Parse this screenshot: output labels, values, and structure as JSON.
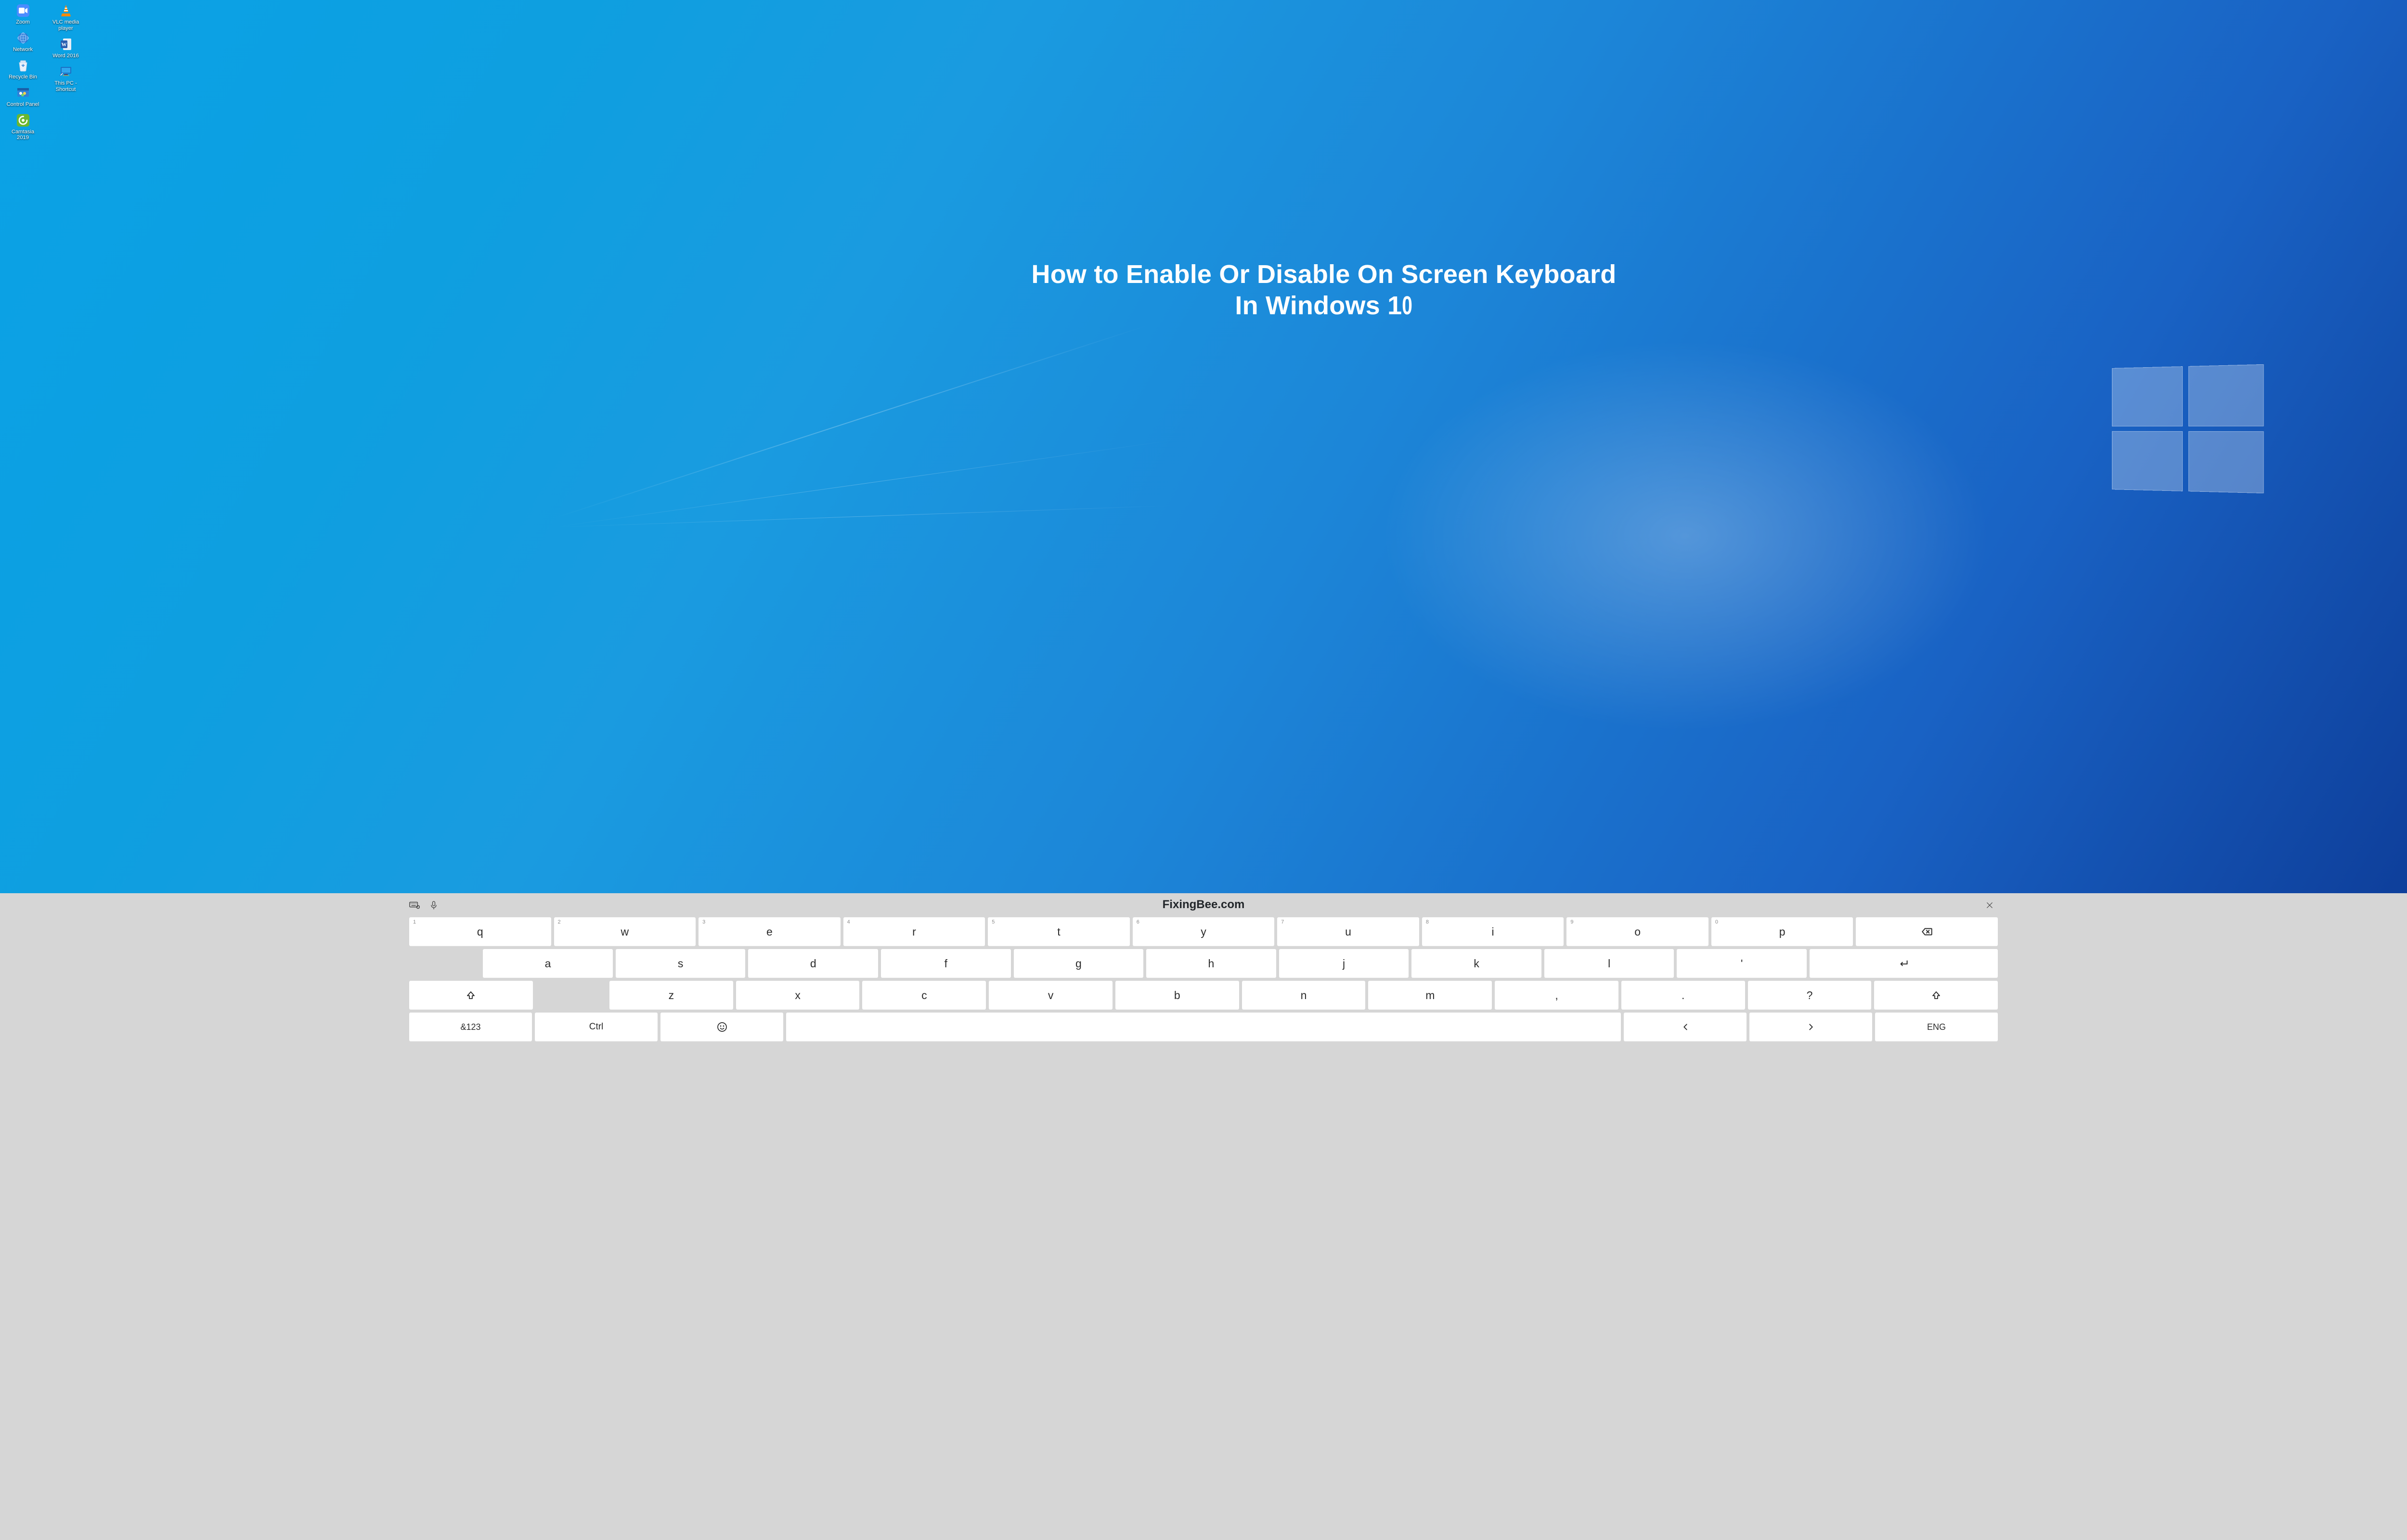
{
  "headline": {
    "line1": "How to Enable Or Disable On Screen Keyboard",
    "line2_a": "In Windows 1",
    "line2_b": "0"
  },
  "brand": "FixingBee.com",
  "desktop": {
    "col1": [
      {
        "id": "zoom",
        "label": "Zoom"
      },
      {
        "id": "network",
        "label": "Network"
      },
      {
        "id": "recycle",
        "label": "Recycle Bin"
      },
      {
        "id": "cpl",
        "label": "Control Panel"
      },
      {
        "id": "camtasia",
        "label": "Camtasia 2019"
      }
    ],
    "col2": [
      {
        "id": "vlc",
        "label": "VLC media player"
      },
      {
        "id": "word",
        "label": "Word 2016"
      },
      {
        "id": "thispc",
        "label": "This PC - Shortcut"
      }
    ]
  },
  "keyboard": {
    "row1": [
      {
        "sup": "1",
        "main": "q"
      },
      {
        "sup": "2",
        "main": "w"
      },
      {
        "sup": "3",
        "main": "e"
      },
      {
        "sup": "4",
        "main": "r"
      },
      {
        "sup": "5",
        "main": "t"
      },
      {
        "sup": "6",
        "main": "y"
      },
      {
        "sup": "7",
        "main": "u"
      },
      {
        "sup": "8",
        "main": "i"
      },
      {
        "sup": "9",
        "main": "o"
      },
      {
        "sup": "0",
        "main": "p"
      }
    ],
    "row2": [
      "a",
      "s",
      "d",
      "f",
      "g",
      "h",
      "j",
      "k",
      "l",
      "'"
    ],
    "row3": [
      "z",
      "x",
      "c",
      "v",
      "b",
      "n",
      "m",
      ",",
      ".",
      "?"
    ],
    "row4": {
      "numsym": "&123",
      "ctrl": "Ctrl",
      "lang": "ENG"
    }
  }
}
